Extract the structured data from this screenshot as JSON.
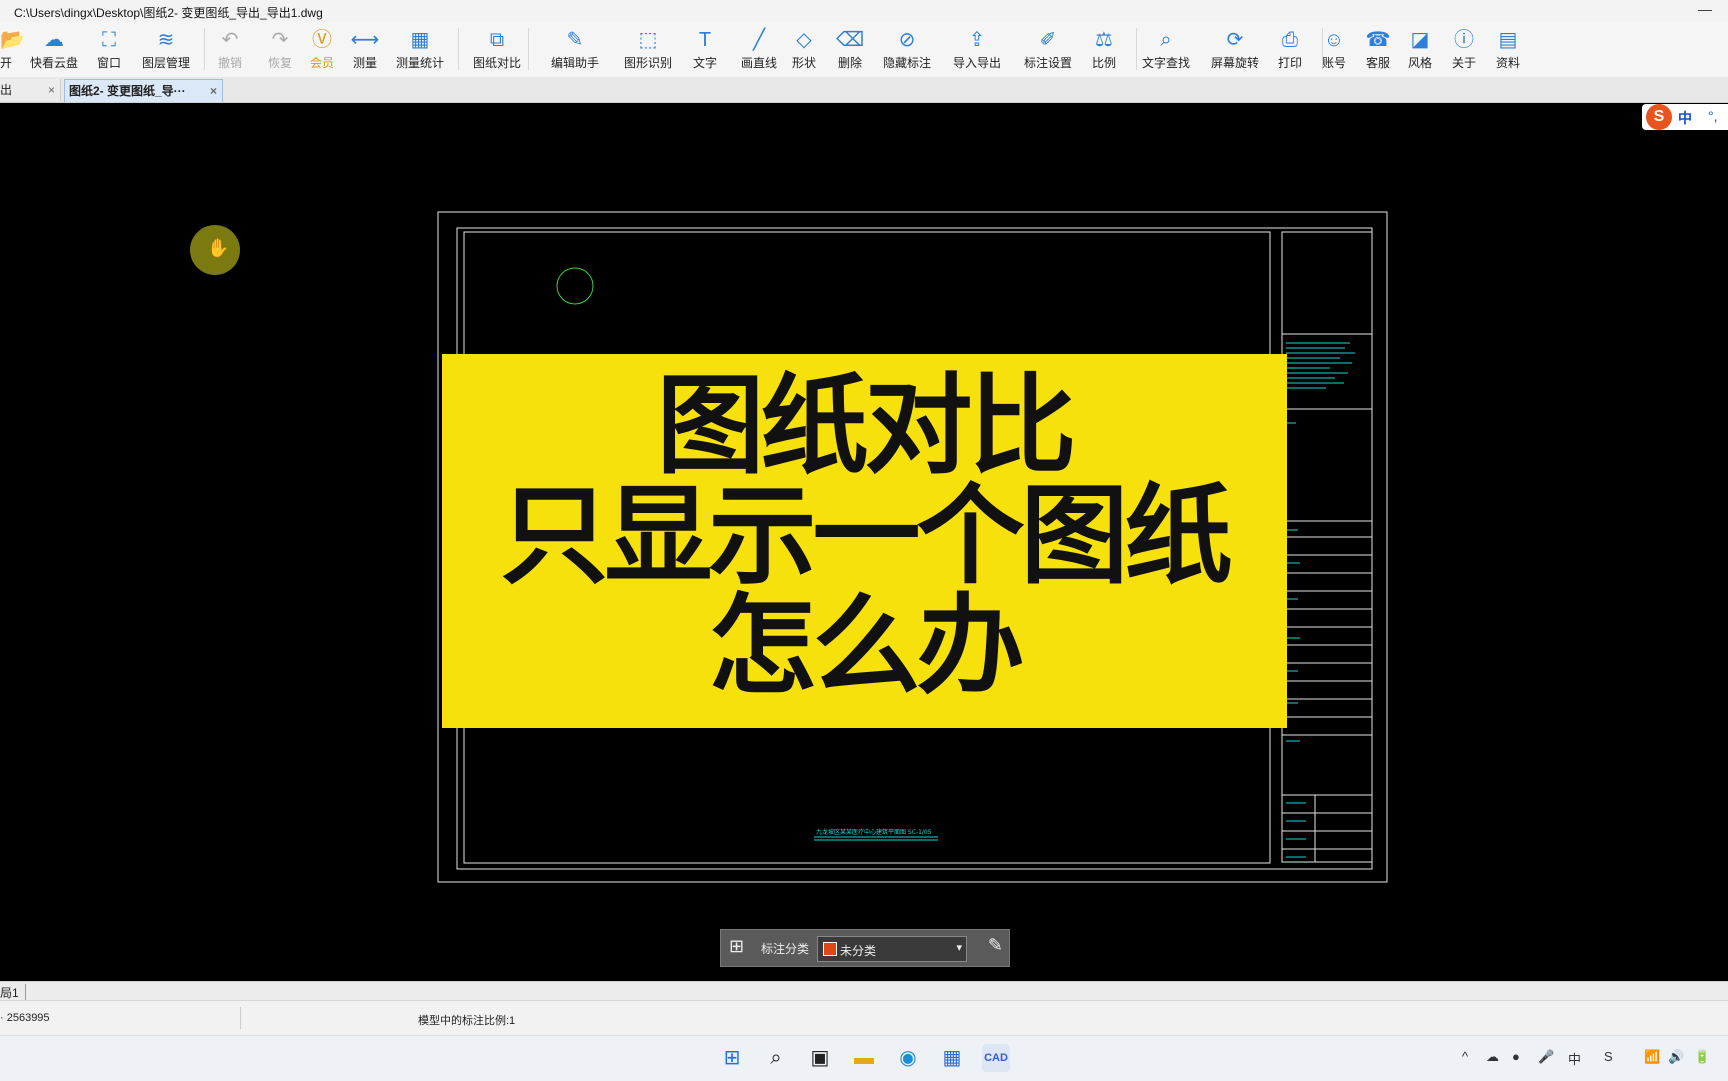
{
  "window": {
    "title": "C:\\Users\\dingx\\Desktop\\图纸2- 变更图纸_导出_导出1.dwg",
    "minimize_glyph": "—"
  },
  "toolbar": {
    "items": [
      {
        "label": "开",
        "icon": "open-icon",
        "glyph": "📂"
      },
      {
        "label": "快看云盘",
        "icon": "cloud-icon",
        "glyph": "☁"
      },
      {
        "label": "窗口",
        "icon": "window-icon",
        "glyph": "⛶"
      },
      {
        "label": "图层管理",
        "icon": "layers-icon",
        "glyph": "≋"
      },
      {
        "label": "撤销",
        "icon": "undo-icon",
        "glyph": "↶"
      },
      {
        "label": "恢复",
        "icon": "redo-icon",
        "glyph": "↷"
      },
      {
        "label": "会员",
        "icon": "vip-icon",
        "glyph": "Ⓥ"
      },
      {
        "label": "测量",
        "icon": "measure-icon",
        "glyph": "⟷"
      },
      {
        "label": "测量统计",
        "icon": "measure-stats-icon",
        "glyph": "▦"
      },
      {
        "label": "图纸对比",
        "icon": "compare-icon",
        "glyph": "⧉"
      },
      {
        "label": "编辑助手",
        "icon": "edit-assistant-icon",
        "glyph": "✎"
      },
      {
        "label": "图形识别",
        "icon": "shape-recognition-icon",
        "glyph": "⬚"
      },
      {
        "label": "文字",
        "icon": "text-icon",
        "glyph": "T"
      },
      {
        "label": "画直线",
        "icon": "line-icon",
        "glyph": "╱"
      },
      {
        "label": "形状",
        "icon": "shape-icon",
        "glyph": "◇"
      },
      {
        "label": "删除",
        "icon": "eraser-icon",
        "glyph": "⌫"
      },
      {
        "label": "隐藏标注",
        "icon": "hide-annotation-icon",
        "glyph": "⊘"
      },
      {
        "label": "导入导出",
        "icon": "import-export-icon",
        "glyph": "⇪"
      },
      {
        "label": "标注设置",
        "icon": "annotation-settings-icon",
        "glyph": "✐"
      },
      {
        "label": "比例",
        "icon": "scale-icon",
        "glyph": "⚖"
      },
      {
        "label": "文字查找",
        "icon": "text-search-icon",
        "glyph": "⌕"
      },
      {
        "label": "屏幕旋转",
        "icon": "screen-rotate-icon",
        "glyph": "⟳"
      },
      {
        "label": "打印",
        "icon": "print-icon",
        "glyph": "⎙"
      },
      {
        "label": "账号",
        "icon": "account-icon",
        "glyph": "☺"
      },
      {
        "label": "客服",
        "icon": "headset-icon",
        "glyph": "☎"
      },
      {
        "label": "风格",
        "icon": "style-icon",
        "glyph": "◪"
      },
      {
        "label": "关于",
        "icon": "info-icon",
        "glyph": "ⓘ"
      },
      {
        "label": "资料",
        "icon": "resources-icon",
        "glyph": "▤"
      }
    ]
  },
  "tabs": [
    {
      "label": "出",
      "close": "×"
    },
    {
      "label": "图纸2- 变更图纸_导···",
      "close": "×"
    }
  ],
  "cursor_glyph": "✋",
  "overlay": {
    "line1": "图纸对比",
    "line2": "只显示一个图纸",
    "line3": "怎么办"
  },
  "ime": {
    "logo": "S",
    "mode": "中",
    "punct": "°,"
  },
  "drawing": {
    "caption": "九龙坡区某某医疗中心建筑平面图 SC-1/05"
  },
  "annotation_bar": {
    "label": "标注分类",
    "selected": "未分类",
    "swatch_color": "#e04812",
    "chevron": "▾",
    "grid_glyph": "⊞",
    "edit_glyph": "✎"
  },
  "layout_tab": "局1",
  "status": {
    "coord": "· 2563995",
    "scale_text": "模型中的标注比例:1"
  },
  "taskbar": {
    "items": [
      {
        "name": "start",
        "glyph": "⊞",
        "color": "#1a73e8"
      },
      {
        "name": "search",
        "glyph": "⌕",
        "color": "#222"
      },
      {
        "name": "task-view",
        "glyph": "▣",
        "color": "#222"
      },
      {
        "name": "explorer",
        "glyph": "▬",
        "color": "#e6a817"
      },
      {
        "name": "edge",
        "glyph": "◉",
        "color": "#1b8fd6"
      },
      {
        "name": "store",
        "glyph": "▦",
        "color": "#2b6fd1"
      },
      {
        "name": "cad",
        "glyph": "CAD",
        "color": "#3060c0"
      }
    ],
    "tray": [
      "^",
      "☁",
      "●",
      "🎤",
      "中",
      "S",
      "📶",
      "🔊",
      "🔋"
    ]
  }
}
